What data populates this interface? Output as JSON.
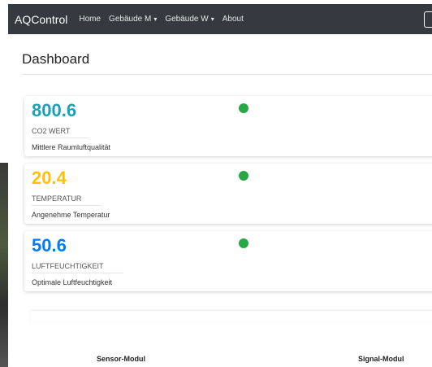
{
  "navbar": {
    "brand": "AQControl",
    "items": [
      {
        "label": "Home",
        "dropdown": false
      },
      {
        "label": "Gebäude M",
        "dropdown": true
      },
      {
        "label": "Gebäude W",
        "dropdown": true
      },
      {
        "label": "About",
        "dropdown": false
      }
    ]
  },
  "page": {
    "title": "Dashboard"
  },
  "cards": [
    {
      "value": "800.6",
      "label": "CO2 WERT",
      "description": "Mittlere Raumluftqualität",
      "value_color": "#17a2b8",
      "status_color": "#28a745"
    },
    {
      "value": "20.4",
      "label": "TEMPERATUR",
      "description": "Angenehme Temperatur",
      "value_color": "#ffc107",
      "status_color": "#28a745"
    },
    {
      "value": "50.6",
      "label": "LUFTFEUCHTIGKEIT",
      "description": "Optimale Luftfeuchtigkeit",
      "value_color": "#007bff",
      "status_color": "#28a745"
    }
  ],
  "modules": {
    "sensor_label": "Sensor-Modul",
    "signal_label": "Signal-Modul"
  }
}
